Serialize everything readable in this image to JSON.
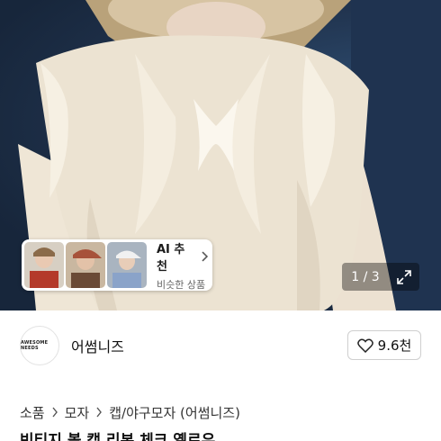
{
  "product_image": {
    "counter": "1 / 3"
  },
  "ai_recommend": {
    "title": "AI 추천",
    "subtitle": "비슷한 상품",
    "thumbnails": [
      "thumb-1",
      "thumb-2",
      "thumb-3"
    ]
  },
  "shop": {
    "name": "어썸니즈",
    "avatar_text": "AWESOME NEEDS",
    "likes": "9.6천"
  },
  "breadcrumb": {
    "items": [
      "소품",
      "모자",
      "캡/야구모자 (어썸니즈)"
    ]
  },
  "product": {
    "title": "빈티지 볼 캡 리본 체크 옐로우"
  },
  "colors": {
    "counter_bg": "rgba(0,0,0,0.38)",
    "text_primary": "#111111",
    "border": "#cfcfcf"
  }
}
